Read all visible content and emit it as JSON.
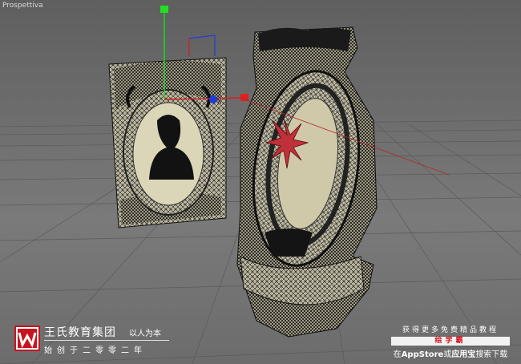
{
  "viewport": {
    "label": "Prospettiva"
  },
  "brand": {
    "logo_letter": "W",
    "name": "王氏教育集团",
    "slogan": "以人为本",
    "year": "始创于二零零二年"
  },
  "promo": {
    "line1": "获得更多免费精品教程",
    "badge": "绘学霸",
    "line3_prefix": "在",
    "line3_store1": "AppStore",
    "line3_or": "或",
    "line3_store2": "应用宝",
    "line3_suffix": "搜索下载"
  },
  "colors": {
    "accent": "#c8141e",
    "wire": "#1a1a1a",
    "model_base": "#d8d2b4",
    "axis_x": "#e02020",
    "axis_y": "#20e020",
    "axis_z": "#2040e0"
  }
}
